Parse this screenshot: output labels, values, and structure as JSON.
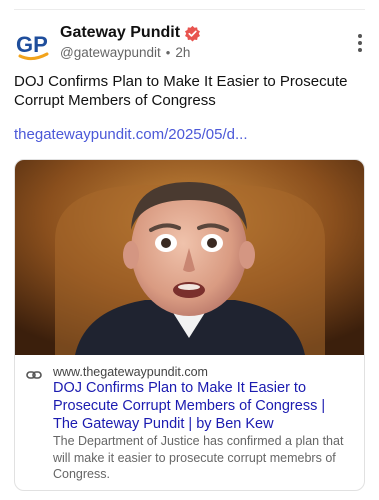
{
  "post": {
    "author_name": "Gateway Pundit",
    "avatar_text": "GP",
    "handle": "@gatewaypundit",
    "time": "2h",
    "text": "DOJ Confirms Plan to Make It Easier to Prosecute Corrupt Members of Congress",
    "link": "thegatewaypundit.com/2025/05/d..."
  },
  "card": {
    "domain": "www.thegatewaypundit.com",
    "title": "DOJ Confirms Plan to Make It Easier to Prosecute Corrupt Members of Congress | The Gateway Pundit | by Ben Kew",
    "description": "The Department of Justice has confirmed a plan that will make it easier to prosecute corrupt memebrs of Congress."
  },
  "colors": {
    "link": "#4c59d8",
    "card_title": "#1b1bb0",
    "verified_badge": "#e8544f",
    "avatar_blue": "#1f4e9c",
    "avatar_orange": "#f2a31b"
  },
  "icons": {
    "verified": "verified-badge-icon",
    "more": "more-vertical-icon",
    "link": "link-chain-icon"
  }
}
